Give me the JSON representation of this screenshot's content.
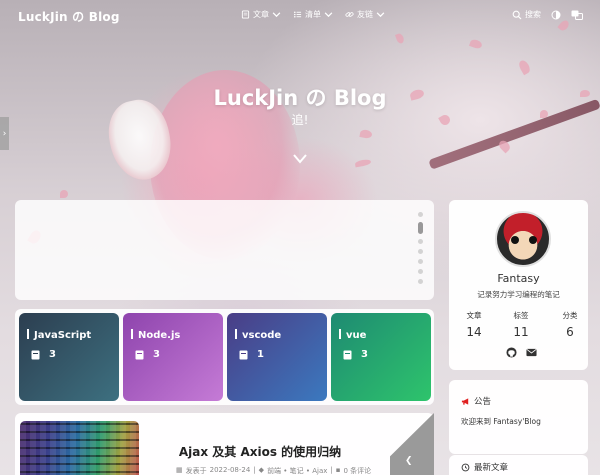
{
  "navbar": {
    "brand": "LuckJin の Blog",
    "menu": [
      {
        "label": "文章",
        "icon": "book-icon"
      },
      {
        "label": "清单",
        "icon": "list-icon"
      },
      {
        "label": "友链",
        "icon": "link-icon"
      }
    ],
    "search_label": "搜索",
    "icons": [
      "search-icon",
      "theme-toggle-icon",
      "translate-icon"
    ]
  },
  "hero": {
    "title": "LuckJin の Blog",
    "subtitle": "追!"
  },
  "categories": [
    {
      "name": "JavaScript",
      "count": "3"
    },
    {
      "name": "Node.js",
      "count": "3"
    },
    {
      "name": "vscode",
      "count": "1"
    },
    {
      "name": "vue",
      "count": "3"
    }
  ],
  "post": {
    "title": "Ajax 及其 Axios 的使用归纳",
    "meta_published": "发表于",
    "meta_date": "2022-08-24",
    "meta_tags": "前端 • 笔记 • Ajax",
    "meta_comments": "0 条评论"
  },
  "profile": {
    "name": "Fantasy",
    "description": "记录努力学习编程的笔记",
    "stats": [
      {
        "label": "文章",
        "value": "14"
      },
      {
        "label": "标签",
        "value": "11"
      },
      {
        "label": "分类",
        "value": "6"
      }
    ]
  },
  "announcement": {
    "heading": "公告",
    "text": "欢迎来到 Fantasy'Blog"
  },
  "recent": {
    "heading": "最新文章"
  },
  "colors": {
    "cat1": [
      "#2c3e50",
      "#3a6a7a"
    ],
    "cat2": [
      "#8e44ad",
      "#c06cd0"
    ],
    "cat3": [
      "#4a3f8a",
      "#3a7ac0"
    ],
    "cat4": [
      "#1f8f6f",
      "#2ecc71"
    ]
  }
}
